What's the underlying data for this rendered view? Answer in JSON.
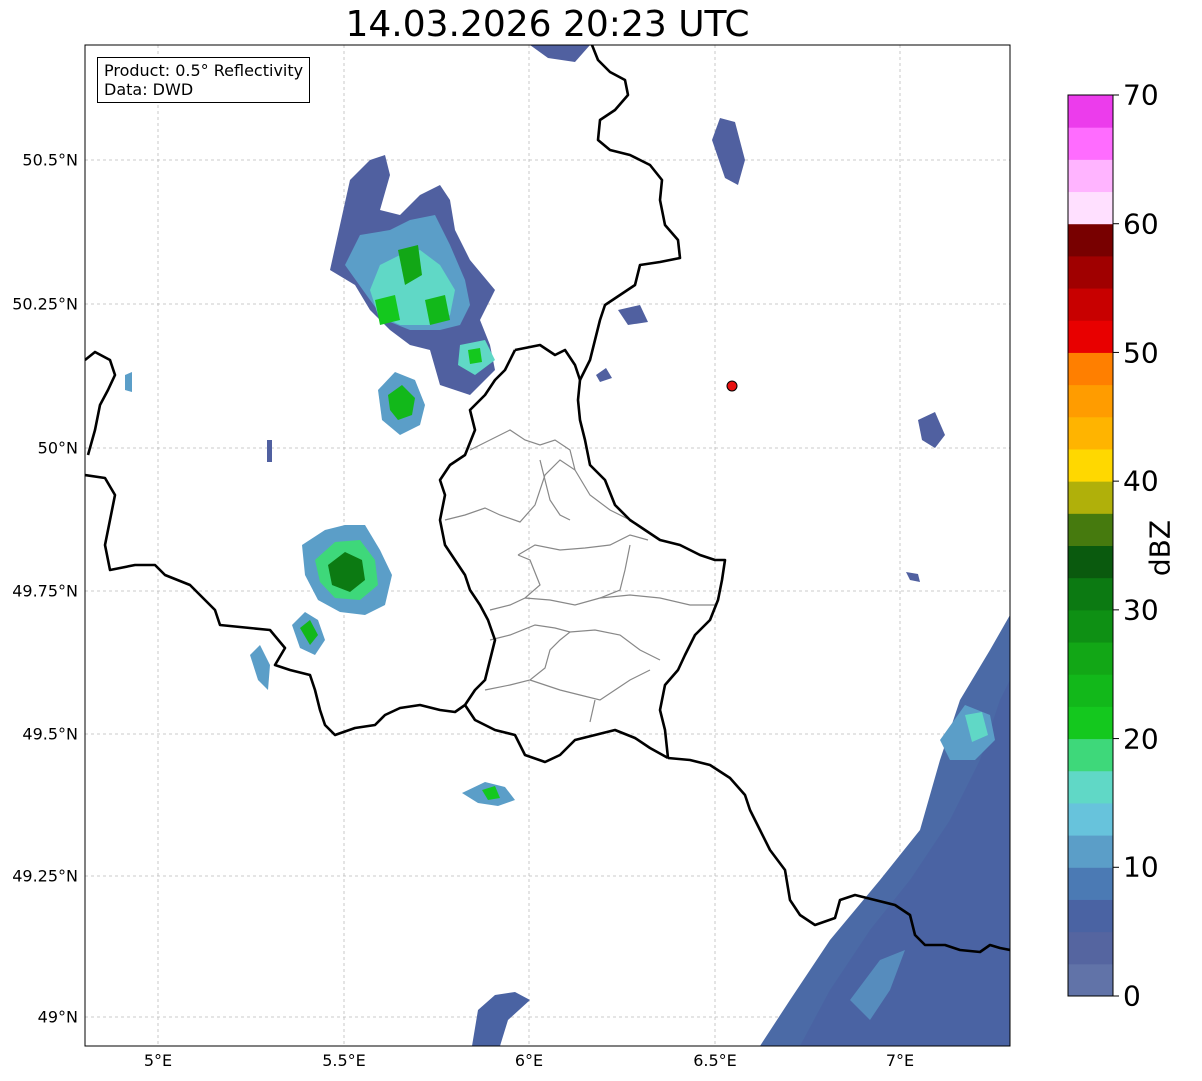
{
  "title": "14.03.2026 20:23 UTC",
  "info": {
    "line1": "Product: 0.5° Reflectivity",
    "line2": "Data: DWD"
  },
  "lat_labels": [
    "50.5°N",
    "50.25°N",
    "50°N",
    "49.75°N",
    "49.5°N",
    "49.25°N",
    "49°N"
  ],
  "lon_labels": [
    "5°E",
    "5.5°E",
    "6°E",
    "6.5°E",
    "7°E"
  ],
  "colorbar": {
    "unit": "dBZ",
    "ticks": [
      "0",
      "10",
      "20",
      "30",
      "40",
      "50",
      "60",
      "70"
    ],
    "colors": [
      "#6173a8",
      "#5565a0",
      "#4a63a3",
      "#4b7ab4",
      "#5b9ec8",
      "#67c3dc",
      "#60d8c6",
      "#3ed87a",
      "#14c81e",
      "#12b81a",
      "#12a716",
      "#0e9014",
      "#0c7a12",
      "#0a5a0e",
      "#467a0e",
      "#b0b00a",
      "#ffd800",
      "#ffb400",
      "#ff9c00",
      "#ff7f00",
      "#e80000",
      "#c80000",
      "#a00000",
      "#780000",
      "#ffe0ff",
      "#ffb4ff",
      "#ff6cff",
      "#ec3cec"
    ]
  },
  "map_colors": {
    "border": "#000000",
    "canton": "#888888",
    "grid": "#bbbbbb",
    "marker": "#e81010"
  },
  "marker": {
    "lon": 6.55,
    "lat": 50.11,
    "label": ""
  }
}
